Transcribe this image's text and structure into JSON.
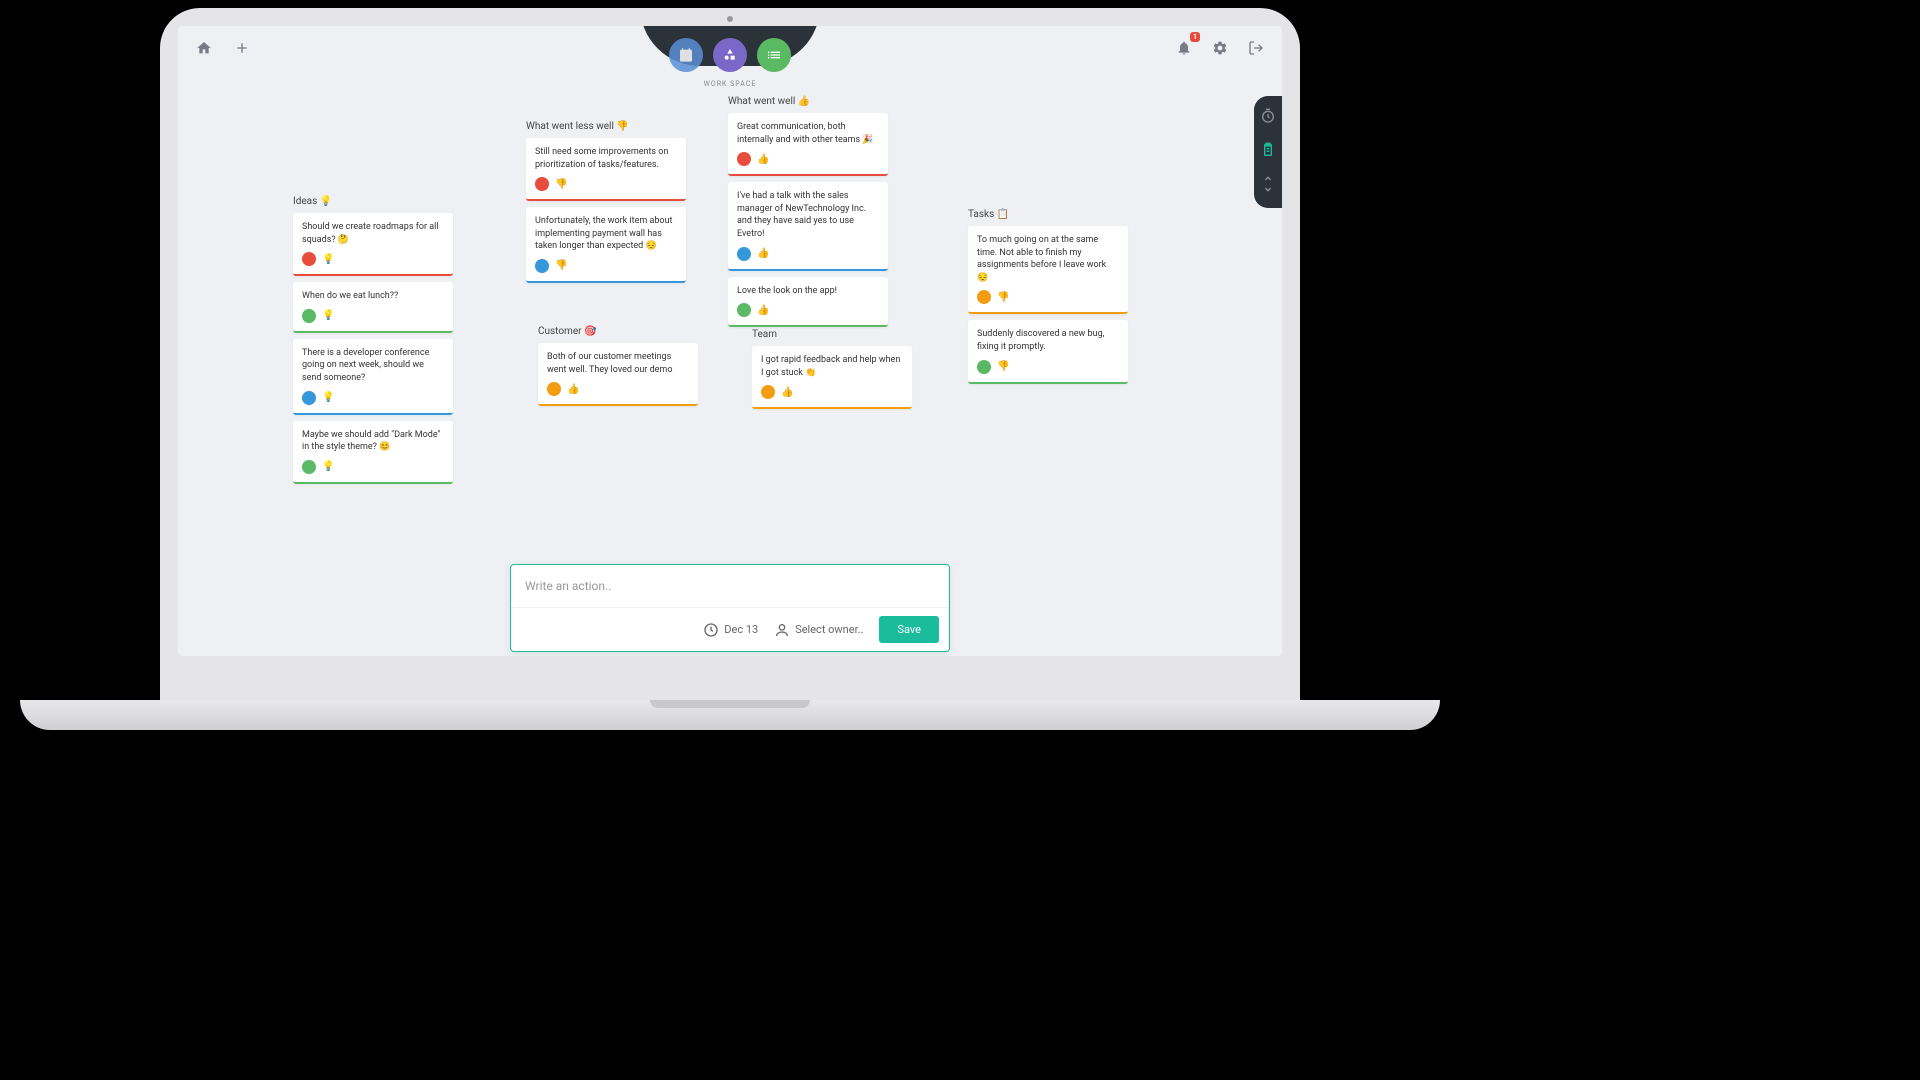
{
  "dock_label": "WORK SPACE",
  "notification_count": "1",
  "columns": {
    "ideas": {
      "title": "Ideas 💡",
      "cards": [
        {
          "text": "Should we create roadmaps for all squads? 🤔",
          "avatar_class": "av-red",
          "icon": "💡",
          "border": "bd-red"
        },
        {
          "text": "When do we eat lunch??",
          "avatar_class": "av-green",
          "icon": "💡",
          "border": "bd-green"
        },
        {
          "text": "There is a developer conference going on next week, should we send someone?",
          "avatar_class": "av-blue",
          "icon": "💡",
          "border": "bd-blue"
        },
        {
          "text": "Maybe we should add \"Dark Mode\" in the style theme? 😊",
          "avatar_class": "av-green",
          "icon": "💡",
          "border": "bd-green"
        }
      ]
    },
    "less_well": {
      "title": "What went less well 👎",
      "cards": [
        {
          "text": "Still need some improvements on prioritization of tasks/features.",
          "avatar_class": "av-red",
          "icon": "👎",
          "border": "bd-red"
        },
        {
          "text": "Unfortunately, the work item about implementing payment wall has taken longer than expected 😔",
          "avatar_class": "av-blue",
          "icon": "👎",
          "border": "bd-blue"
        }
      ]
    },
    "went_well": {
      "title": "What went well 👍",
      "cards": [
        {
          "text": "Great communication, both internally and with other teams 🎉",
          "avatar_class": "av-red",
          "icon": "👍",
          "border": "bd-red"
        },
        {
          "text": "I've had a talk with the sales manager of NewTechnology Inc. and they have said yes to use Evetro!",
          "avatar_class": "av-blue",
          "icon": "👍",
          "border": "bd-blue"
        },
        {
          "text": "Love the look on the app!",
          "avatar_class": "av-green",
          "icon": "👍",
          "border": "bd-green"
        }
      ]
    },
    "customer": {
      "title": "Customer 🎯",
      "cards": [
        {
          "text": "Both of our customer meetings went well. They loved our demo",
          "avatar_class": "av-orange",
          "icon": "👍",
          "border": "bd-orange"
        }
      ]
    },
    "team": {
      "title": "Team",
      "cards": [
        {
          "text": "I got rapid feedback and help when I got stuck 👏",
          "avatar_class": "av-orange",
          "icon": "👍",
          "border": "bd-orange"
        }
      ]
    },
    "tasks": {
      "title": "Tasks 📋",
      "cards": [
        {
          "text": "To much going on at the same time. Not able to finish my assignments before I leave work 😔",
          "avatar_class": "av-orange",
          "icon": "👎",
          "border": "bd-orange"
        },
        {
          "text": "Suddenly discovered a new bug, fixing it promptly.",
          "avatar_class": "av-green",
          "icon": "👎",
          "border": "bd-green"
        }
      ]
    }
  },
  "action": {
    "placeholder": "Write an action..",
    "date": "Dec 13",
    "owner_placeholder": "Select owner..",
    "save_label": "Save"
  }
}
